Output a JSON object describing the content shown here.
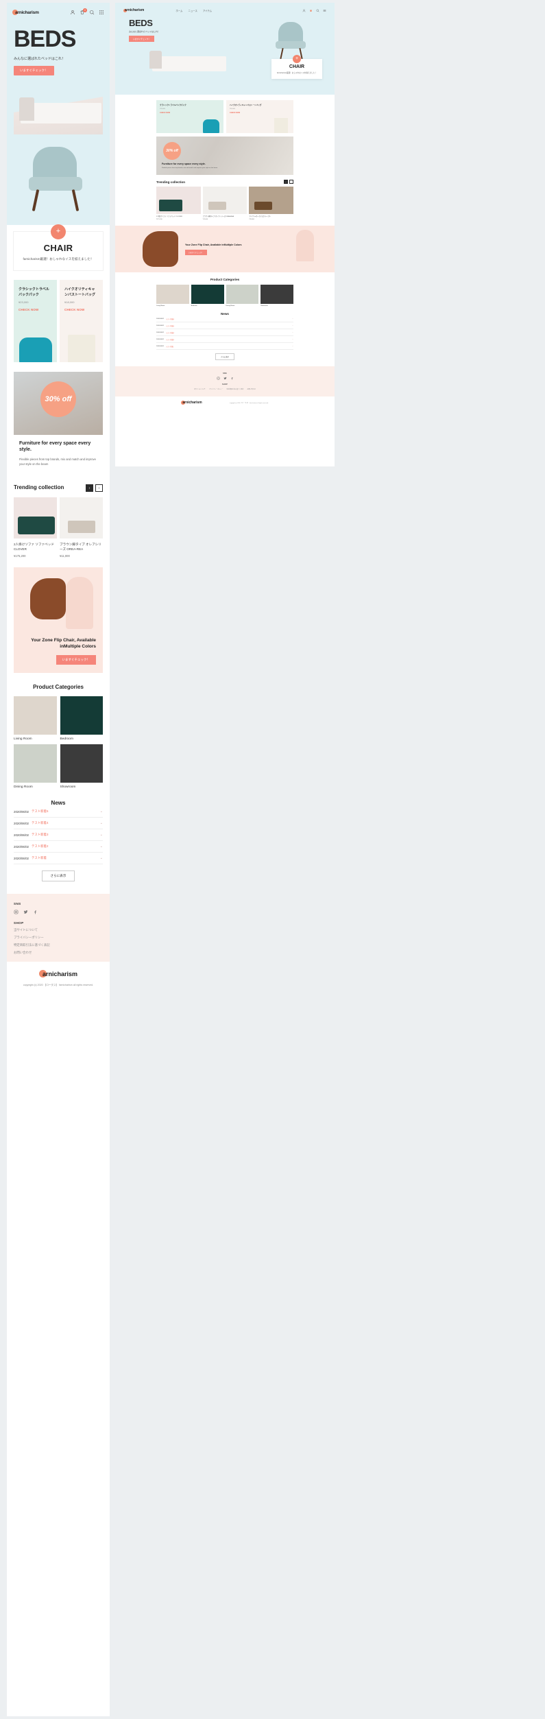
{
  "brand": {
    "name": "arnicharism",
    "dot_color": "#f08a6a"
  },
  "header": {
    "icons": [
      "user-icon",
      "cart-icon",
      "search-icon",
      "menu-icon"
    ],
    "cart_badge": "0",
    "nav": [
      "ホーム",
      "ニュース",
      "アイテム"
    ]
  },
  "hero": {
    "title": "BEDS",
    "subtitle": "みんなに選ばれたベッドはこれ！",
    "cta": "いますぐチェック！"
  },
  "chair_card": {
    "plus": "+",
    "title": "CHAIR",
    "desc": "farnicharism厳選！おしゃれなイスを揃えました！"
  },
  "products": [
    {
      "name": "クラシックトラベルバックパック",
      "price": "¥23,000",
      "cta": "CHECK NOW"
    },
    {
      "name": "ハイクオリティキャンバストートバッグ",
      "price": "¥18,000",
      "cta": "CHECK NOW"
    }
  ],
  "promo": {
    "badge": "30% off",
    "heading": "Furniture for every space every style.",
    "paragraph": "Flexible pieces from top brands, mix and match and improve your style on the beam"
  },
  "trending": {
    "title": "Trending collection",
    "prev": "‹",
    "next": "›",
    "items": [
      {
        "name": "2人掛けソファ ソファベッド CLOVER",
        "price": "¥175,200"
      },
      {
        "name": "ブラウン脚タイプ オレアシリーズ OREA-REA",
        "price": "¥11,000"
      },
      {
        "name": "アイアンxオークデスクテーブル",
        "price": "¥39,800"
      }
    ]
  },
  "zone": {
    "heading": "Your Zone Flip Chair, Available inMultiple Colors",
    "cta": "いますぐチェック！"
  },
  "categories": {
    "title": "Product Categories",
    "items": [
      {
        "label": "Living Room"
      },
      {
        "label": "Bedroom"
      },
      {
        "label": "Dining Room"
      },
      {
        "label": "Showroom"
      }
    ]
  },
  "news": {
    "title": "News",
    "more": "さらに表示",
    "chevron": "⌄",
    "rows": [
      {
        "date": "2020/06/02",
        "link": "テスト新着5"
      },
      {
        "date": "2020/06/02",
        "link": "テスト新着4"
      },
      {
        "date": "2020/06/02",
        "link": "テスト新着3"
      },
      {
        "date": "2020/06/02",
        "link": "テスト新着2"
      },
      {
        "date": "2020/06/02",
        "link": "テスト新着"
      }
    ]
  },
  "footer": {
    "sns_heading": "SNS",
    "shop_heading": "SHOP",
    "social": [
      "instagram-icon",
      "twitter-icon",
      "facebook-icon"
    ],
    "links": [
      "当サイトについて",
      "プライバシーポリシー",
      "特定商取引法に基づく表記",
      "お問い合わせ"
    ],
    "copyright": "copyright (c) 2020 【ロータス】 farnicharism all rights reserved."
  }
}
